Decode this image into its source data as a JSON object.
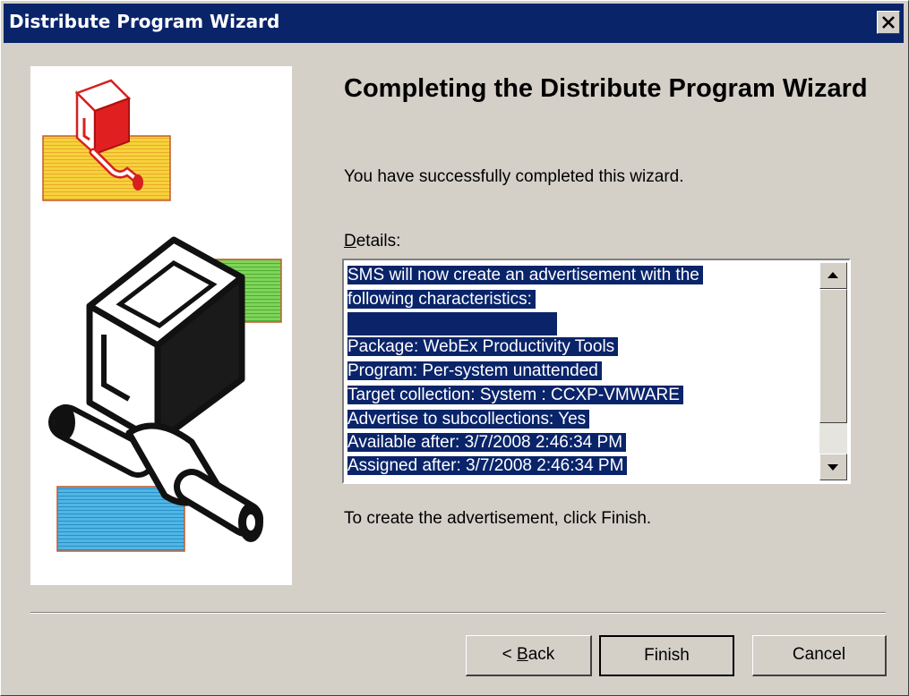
{
  "window": {
    "title": "Distribute Program Wizard"
  },
  "content": {
    "heading": "Completing the Distribute Program Wizard",
    "intro": "You have successfully completed this wizard.",
    "details_label_mnemonic": "D",
    "details_label_rest": "etails:",
    "details_lines": [
      "SMS will now create an advertisement with the",
      "following characteristics:",
      "",
      "Package: WebEx Productivity Tools",
      "Program: Per-system unattended",
      "Target collection: System : CCXP-VMWARE",
      "Advertise to subcollections: Yes",
      "Available after: 3/7/2008 2:46:34 PM",
      "Assigned after: 3/7/2008 2:46:34 PM"
    ],
    "finish_note": "To create the advertisement, click Finish."
  },
  "buttons": {
    "back_prefix": "< ",
    "back_mnemonic": "B",
    "back_rest": "ack",
    "finish": "Finish",
    "cancel": "Cancel"
  },
  "icons": {
    "close": "close-icon",
    "scroll_up": "arrow-up-icon",
    "scroll_down": "arrow-down-icon",
    "wizard_art": "program-box-illustration"
  },
  "colors": {
    "titlebar": "#0a246a",
    "selection": "#0a246a",
    "dialog": "#d4d0c8"
  }
}
